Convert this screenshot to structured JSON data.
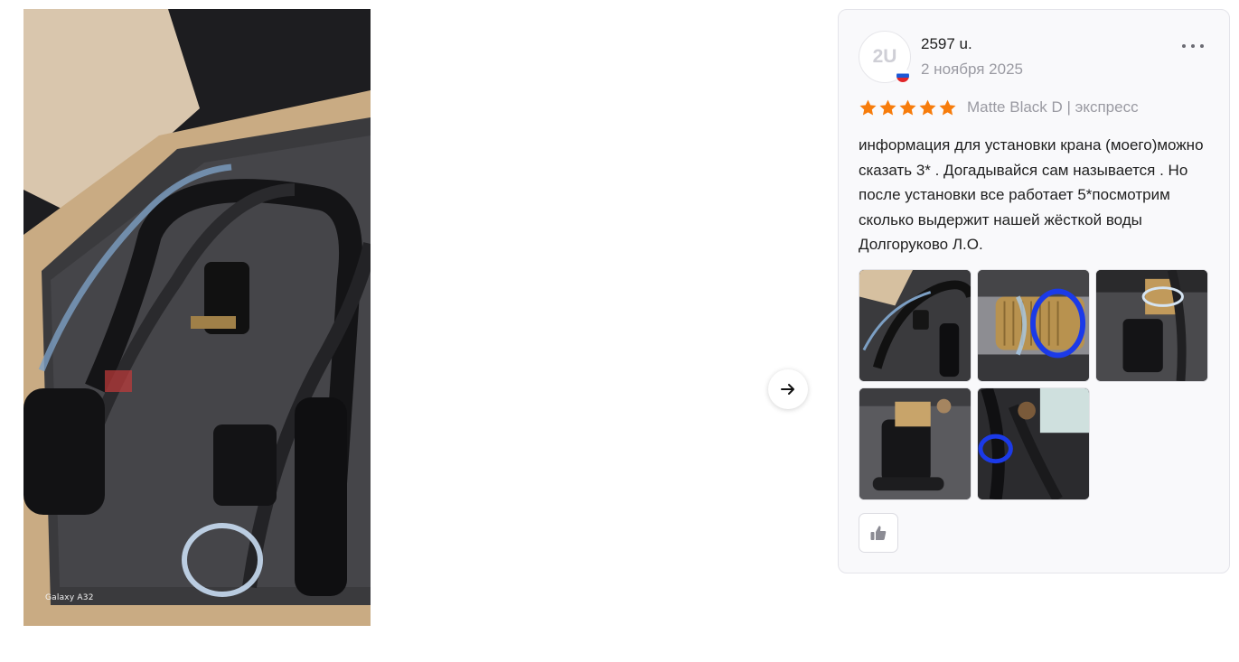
{
  "main_photo": {
    "alt": "Galaxy A32",
    "watermark": "Galaxy A32"
  },
  "navigation": {
    "next_icon": "arrow-right-icon"
  },
  "review": {
    "avatar_initials": "2U",
    "country_flag": "russia-flag-icon",
    "author": "2597 u.",
    "date": "2 ноября 2025",
    "menu_icon": "more-horizontal-icon",
    "rating": 5,
    "rating_max": 5,
    "star_color": "#f77c0b",
    "variant": "Matte Black D | экспресс",
    "text": "информация для установки крана (моего)можно сказать 3* . Догадывайся сам называется . Но после установки все работает 5*посмотрим сколько выдержит нашей жёсткой воды Долгоруково Л.О.",
    "photo_count": 5,
    "like_icon": "thumbs-up-icon"
  }
}
